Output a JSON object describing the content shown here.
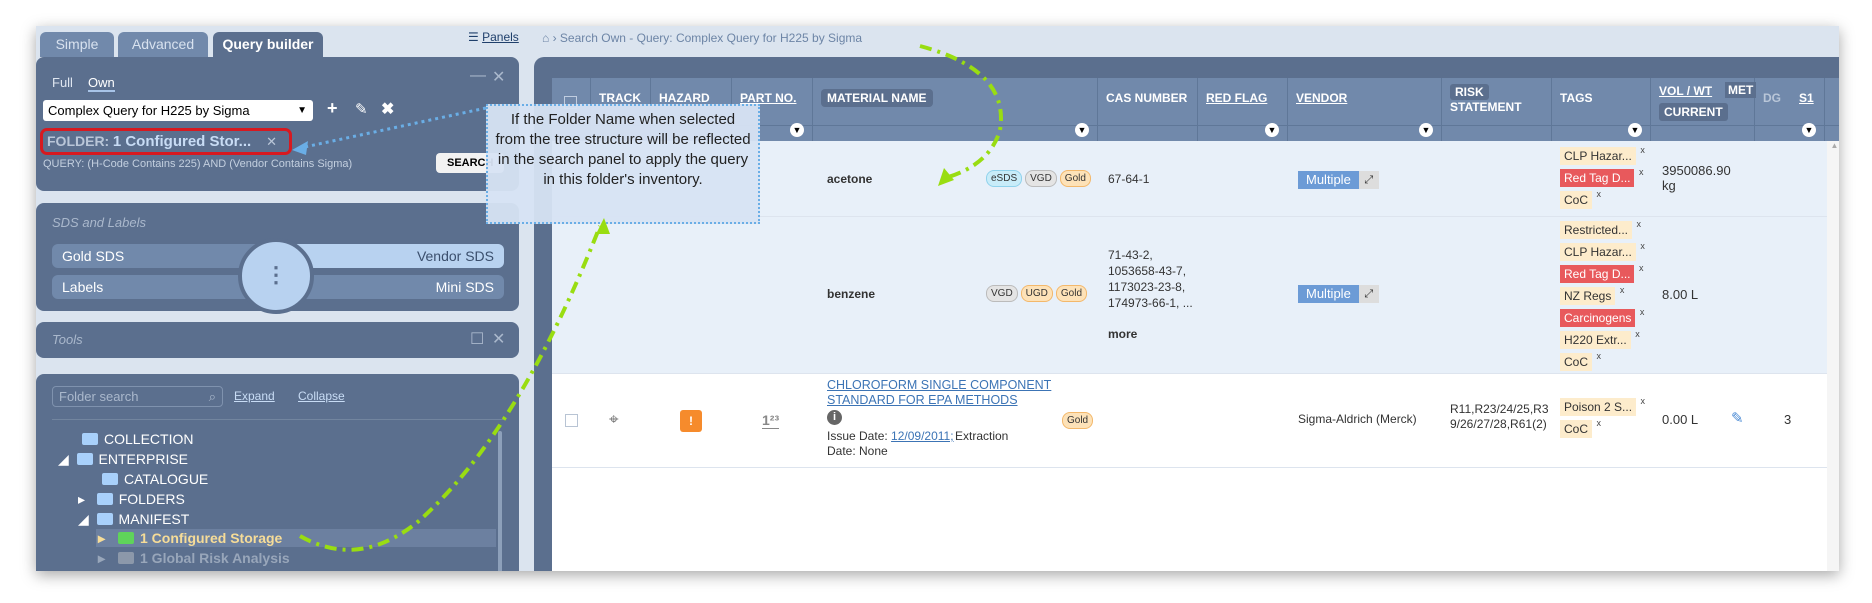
{
  "tabs": [
    "Simple",
    "Advanced",
    "Query builder"
  ],
  "panels_link": "Panels",
  "query_panel": {
    "modes": [
      "Full",
      "Own"
    ],
    "selected_query": "Complex Query for H225 by Sigma",
    "folder_label": "FOLDER:",
    "folder_value": "1 Configured Stor...",
    "query_text": "QUERY: (H-Code Contains 225) AND (Vendor Contains Sigma)",
    "search_button": "SEARCH"
  },
  "sds_panel": {
    "title": "SDS and Labels",
    "gold": "Gold SDS",
    "vendor": "Vendor SDS",
    "labels": "Labels",
    "mini": "Mini SDS"
  },
  "tools_panel": {
    "title": "Tools"
  },
  "folder_panel": {
    "search_placeholder": "Folder search",
    "expand": "Expand",
    "collapse": "Collapse",
    "items": [
      "COLLECTION",
      "ENTERPRISE",
      "CATALOGUE",
      "FOLDERS",
      "MANIFEST",
      "1 Configured Storage",
      "1 Global Risk Analysis"
    ]
  },
  "breadcrumb": "Search Own - Query: Complex Query for H225 by Sigma",
  "callout": "If the Folder Name when selected from the tree structure will be reflected in the search panel to apply the query in this folder's inventory.",
  "columns": {
    "track": "TRACK",
    "hazard": "HAZARD",
    "part": "PART NO.",
    "material": "MATERIAL NAME",
    "cas": "CAS NUMBER",
    "redflag": "RED FLAG",
    "vendor": "VENDOR",
    "risk1": "RISK",
    "risk2": "STATEMENT",
    "tags": "TAGS",
    "vol": "VOL / WT",
    "met": "MET",
    "current": "CURRENT",
    "dg": "DG",
    "s1": "S1"
  },
  "rows": [
    {
      "name": "acetone",
      "badges": [
        "eSDS",
        "VGD",
        "Gold"
      ],
      "cas": "67-64-1",
      "vendor": "Multiple",
      "tags": [
        "CLP Hazar...",
        "Red Tag D...",
        "CoC"
      ],
      "vol": "3950086.90 kg"
    },
    {
      "name": "benzene",
      "badges": [
        "VGD",
        "UGD",
        "Gold"
      ],
      "cas": "71-43-2, 1053658-43-7, 1173023-23-8, 174973-66-1, ...",
      "more": "more",
      "vendor": "Multiple",
      "tags": [
        "Restricted...",
        "CLP Hazar...",
        "Red Tag D...",
        "NZ Regs",
        "Carcinogens",
        "H220 Extr...",
        "CoC"
      ],
      "vol": "8.00 L"
    },
    {
      "name": "CHLOROFORM SINGLE COMPONENT STANDARD FOR EPA METHODS",
      "badges": [
        "Gold"
      ],
      "issue_label": "Issue Date:",
      "issue_date": "12/09/2011;",
      "extraction": "Extraction Date: None",
      "vendor": "Sigma-Aldrich (Merck)",
      "risk": "R11,R23/24/25,R39/26/27/28,R61(2)",
      "tags": [
        "Poison 2 S...",
        "CoC"
      ],
      "vol": "0.00 L",
      "dg": "3",
      "part_icon": "1²³"
    }
  ]
}
